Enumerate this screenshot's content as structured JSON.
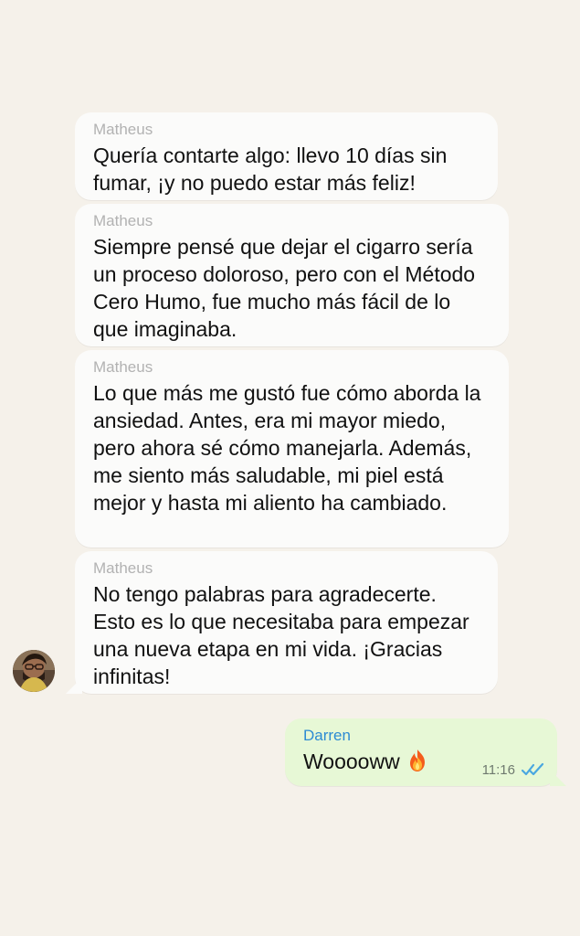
{
  "messages": [
    {
      "sender": "Matheus",
      "text": "Quería contarte algo: llevo 10 días sin fumar, ¡y no puedo estar más feliz!"
    },
    {
      "sender": "Matheus",
      "text": "Siempre pensé que dejar el cigarro sería un proceso doloroso, pero con el Método Cero Humo, fue mucho más fácil de lo que imaginaba."
    },
    {
      "sender": "Matheus",
      "text": "Lo que más me gustó fue cómo aborda la ansiedad. Antes, era mi mayor miedo, pero ahora sé cómo manejarla. Además, me siento más saludable, mi piel está mejor y hasta mi aliento ha cambiado."
    },
    {
      "sender": "Matheus",
      "text": "No tengo palabras para agradecerte. Esto es lo que necesitaba para empezar una nueva etapa en mi vida. ¡Gracias infinitas!"
    },
    {
      "sender": "Darren",
      "text": "Wooooww",
      "time": "11:16",
      "status_icon": "double-check-icon",
      "emoji_icon": "fire-icon"
    }
  ],
  "colors": {
    "background": "#f5f1ea",
    "incoming_bubble": "#fbfbfa",
    "outgoing_bubble": "#e7f8d6",
    "incoming_sender": "#b2b2b2",
    "outgoing_sender": "#2d8bd3",
    "tick": "#4aa7e0"
  },
  "icons": {
    "avatar": "avatar-icon",
    "status": "double-check-icon",
    "fire": "fire-icon"
  }
}
